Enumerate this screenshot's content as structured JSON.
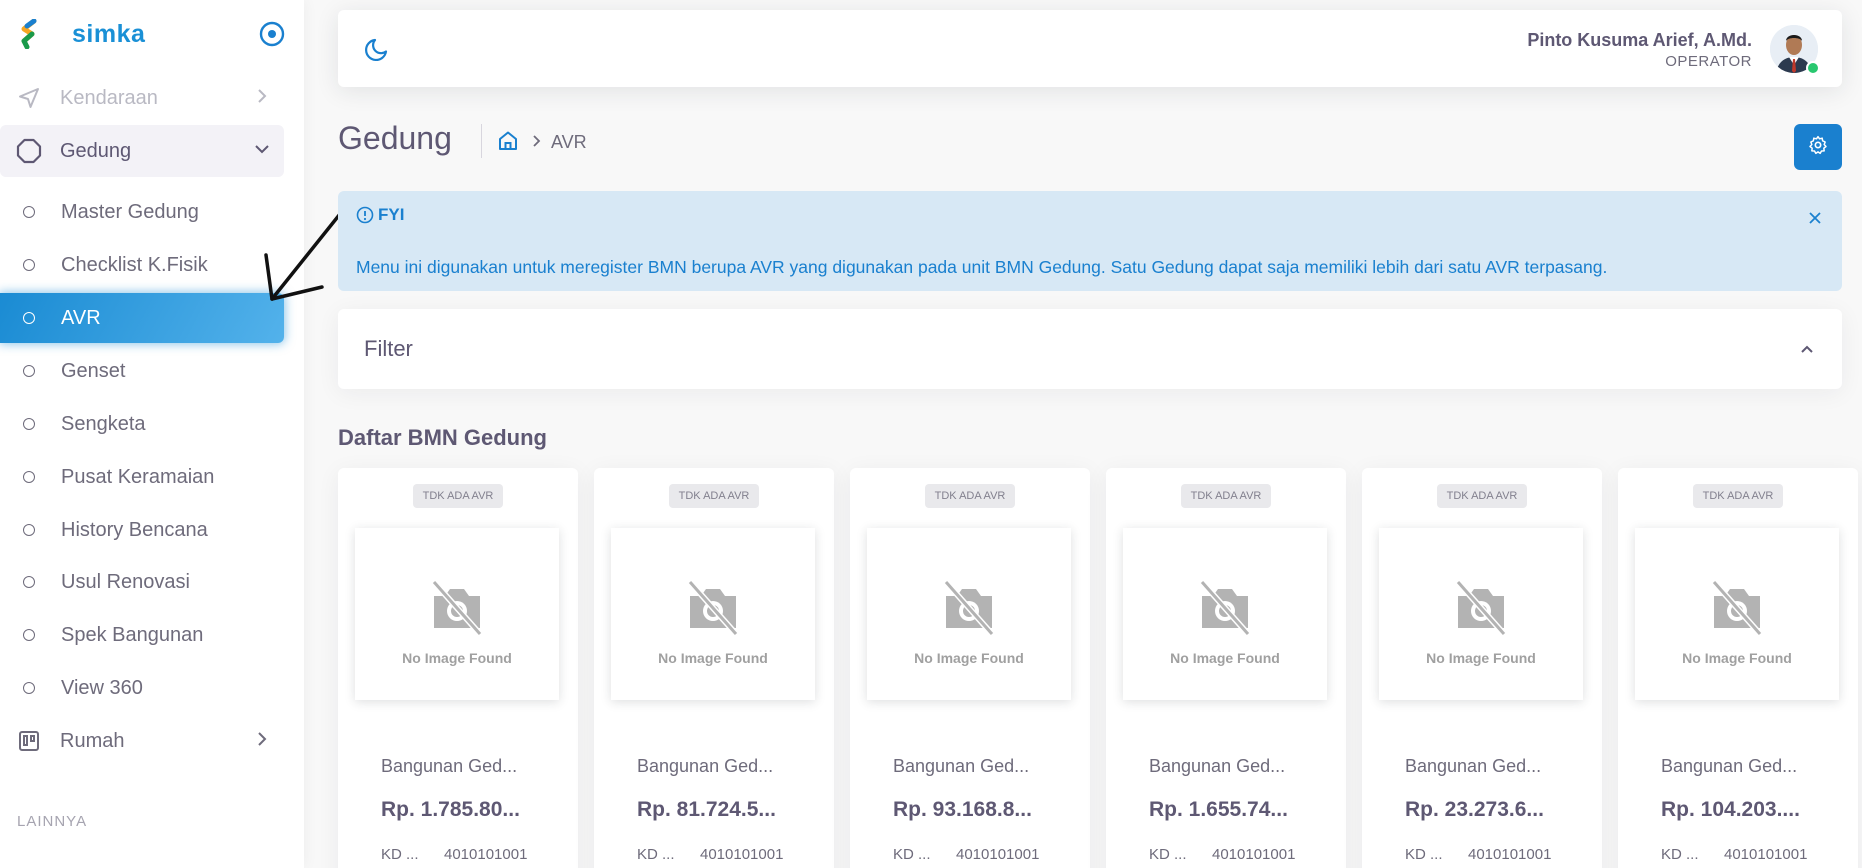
{
  "brand": {
    "name": "simka",
    "logo_icon": "simka-logo-icon",
    "toggle_icon": "circle-dot-icon"
  },
  "sidebar": {
    "kendaraan": "Kendaraan",
    "gedung": "Gedung",
    "sub_items": [
      {
        "label": "Master Gedung"
      },
      {
        "label": "Checklist K.Fisik"
      },
      {
        "label": "AVR",
        "active": true
      },
      {
        "label": "Genset"
      },
      {
        "label": "Sengketa"
      },
      {
        "label": "Pusat Keramaian"
      },
      {
        "label": "History Bencana"
      },
      {
        "label": "Usul Renovasi"
      },
      {
        "label": "Spek Bangunan"
      },
      {
        "label": "View 360"
      }
    ],
    "rumah": "Rumah",
    "section_lainnya": "LAINNYA"
  },
  "header": {
    "user_name": "Pinto Kusuma Arief, A.Md.",
    "user_role": "OPERATOR",
    "status_color": "#28c76f"
  },
  "page": {
    "title": "Gedung",
    "breadcrumb_current": "AVR"
  },
  "alert": {
    "title": "FYI",
    "body": "Menu ini digunakan untuk meregister BMN berupa AVR yang digunakan pada unit BMN Gedung. Satu Gedung dapat saja memiliki lebih dari satu AVR terpasang."
  },
  "filter": {
    "title": "Filter"
  },
  "list": {
    "title": "Daftar BMN Gedung",
    "cards": [
      {
        "badge": "TDK ADA AVR",
        "no_image": "No Image Found",
        "name": "Bangunan Ged...",
        "price": "Rp. 1.785.80...",
        "kd": "KD ...",
        "code": "4010101001"
      },
      {
        "badge": "TDK ADA AVR",
        "no_image": "No Image Found",
        "name": "Bangunan Ged...",
        "price": "Rp. 81.724.5...",
        "kd": "KD ...",
        "code": "4010101001"
      },
      {
        "badge": "TDK ADA AVR",
        "no_image": "No Image Found",
        "name": "Bangunan Ged...",
        "price": "Rp. 93.168.8...",
        "kd": "KD ...",
        "code": "4010101001"
      },
      {
        "badge": "TDK ADA AVR",
        "no_image": "No Image Found",
        "name": "Bangunan Ged...",
        "price": "Rp. 1.655.74...",
        "kd": "KD ...",
        "code": "4010101001"
      },
      {
        "badge": "TDK ADA AVR",
        "no_image": "No Image Found",
        "name": "Bangunan Ged...",
        "price": "Rp. 23.273.6...",
        "kd": "KD ...",
        "code": "4010101001"
      },
      {
        "badge": "TDK ADA AVR",
        "no_image": "No Image Found",
        "name": "Bangunan Ged...",
        "price": "Rp. 104.203....",
        "kd": "KD ...",
        "code": "4010101001"
      }
    ]
  },
  "colors": {
    "primary": "#1a80cf",
    "alert_bg": "#d7e8f5"
  }
}
